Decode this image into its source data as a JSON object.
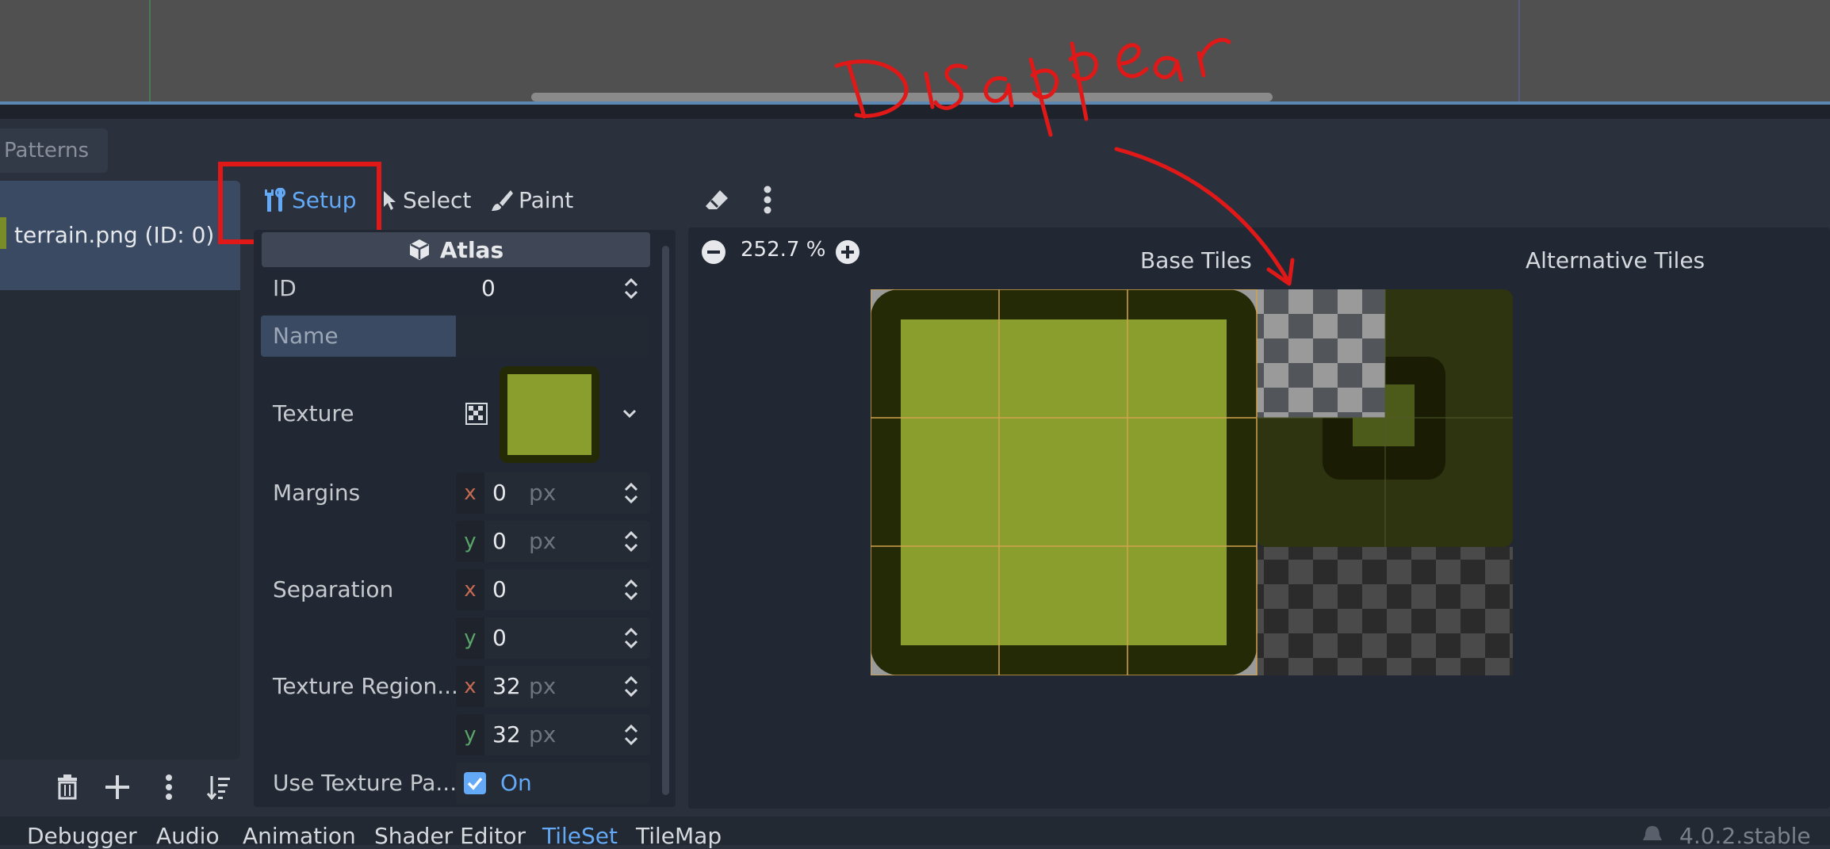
{
  "patterns_tab": "Patterns",
  "sources": {
    "item_label": "terrain.png (ID: 0)"
  },
  "toolbar": {
    "setup": "Setup",
    "select": "Select",
    "paint": "Paint"
  },
  "inspector": {
    "header": "Atlas",
    "id_label": "ID",
    "id_value": "0",
    "name_label": "Name",
    "name_value": "",
    "texture_label": "Texture",
    "margins_label": "Margins",
    "margins": {
      "x": "0",
      "y": "0",
      "unit": "px"
    },
    "separation_label": "Separation",
    "separation": {
      "x": "0",
      "y": "0"
    },
    "region_label": "Texture Region...",
    "region": {
      "x": "32",
      "y": "32",
      "unit": "px"
    },
    "padding_label": "Use Texture Pa...",
    "padding_value": "On",
    "axis_x": "x",
    "axis_y": "y"
  },
  "atlas_view": {
    "zoom": "252.7 %",
    "base_tiles_label": "Base Tiles",
    "alternative_tiles_label": "Alternative Tiles"
  },
  "bottom_bar": {
    "items": [
      "Debugger",
      "Audio",
      "Animation",
      "Shader Editor",
      "TileSet",
      "TileMap"
    ],
    "active": "TileSet",
    "version": "4.0.2.stable"
  },
  "annotation": {
    "text": "Disappear",
    "color": "#e01818"
  },
  "colors": {
    "accent": "#63a9f6",
    "tile_green": "#8a9e2e",
    "tile_dark": "#242a06",
    "highlight": "#e01818"
  }
}
